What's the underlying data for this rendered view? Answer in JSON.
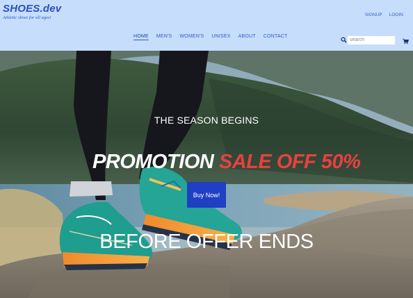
{
  "brand": {
    "name": "SHOES.dev",
    "tagline": "Athletic shoes for all ages!"
  },
  "auth": {
    "signup": "SIGNUP",
    "login": "LOGIN"
  },
  "nav": {
    "items": [
      {
        "label": "HOME",
        "active": true
      },
      {
        "label": "MEN'S"
      },
      {
        "label": "WOMEN'S"
      },
      {
        "label": "UNISEX"
      },
      {
        "label": "ABOUT"
      },
      {
        "label": "CONTACT"
      }
    ]
  },
  "search": {
    "placeholder": "search",
    "value": ""
  },
  "icons": {
    "search": "search-icon",
    "cart": "cart-icon"
  },
  "hero": {
    "kicker": "THE SEASON BEGINS",
    "headline_white": "PROMOTION ",
    "headline_red": "SALE OFF 50%",
    "button": "Buy Now!",
    "footer": "BEFORE OFFER ENDS"
  },
  "colors": {
    "header_bg": "#c6defc",
    "brand": "#2b4fbf",
    "accent_red": "#e8413f",
    "button_bg": "#1f3fc4"
  }
}
